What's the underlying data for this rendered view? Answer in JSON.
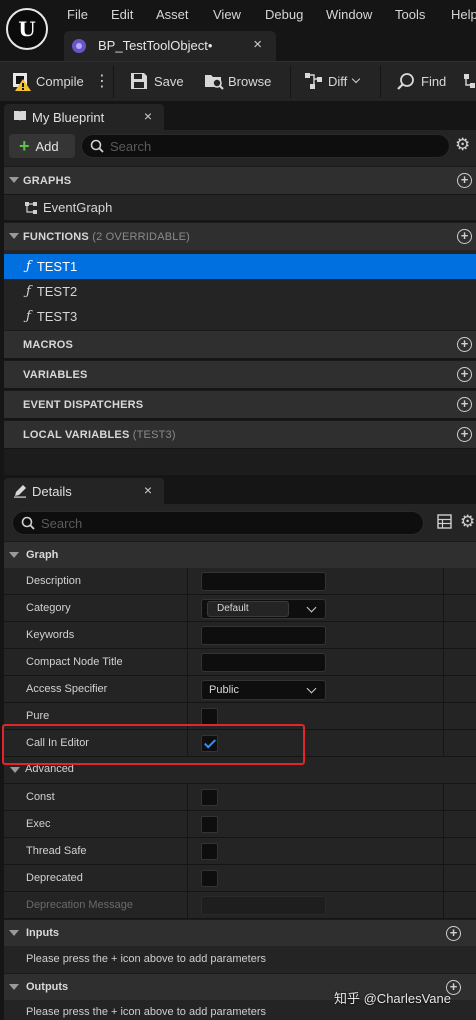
{
  "menu": {
    "items": [
      "File",
      "Edit",
      "Asset",
      "View",
      "Debug",
      "Window",
      "Tools",
      "Help"
    ]
  },
  "document_tab": {
    "title": "BP_TestToolObject•"
  },
  "toolbar": {
    "compile": "Compile",
    "save": "Save",
    "browse": "Browse",
    "diff": "Diff",
    "find": "Find"
  },
  "my_blueprint": {
    "tab_title": "My Blueprint",
    "add_label": "Add",
    "search_placeholder": "Search",
    "sections": {
      "graphs": "GRAPHS",
      "functions": "FUNCTIONS",
      "functions_sub": "(2 OVERRIDABLE)",
      "macros": "MACROS",
      "variables": "VARIABLES",
      "event_dispatchers": "EVENT DISPATCHERS",
      "local_variables": "LOCAL VARIABLES",
      "local_variables_sub": "(TEST3)"
    },
    "graphs": [
      "EventGraph"
    ],
    "functions": [
      "TEST1",
      "TEST2",
      "TEST3"
    ],
    "selected_function": "TEST1"
  },
  "details": {
    "tab_title": "Details",
    "search_placeholder": "Search",
    "graph_section": "Graph",
    "labels": {
      "description": "Description",
      "category": "Category",
      "keywords": "Keywords",
      "compact_node_title": "Compact Node Title",
      "access_specifier": "Access Specifier",
      "pure": "Pure",
      "call_in_editor": "Call In Editor",
      "advanced": "Advanced",
      "const": "Const",
      "exec": "Exec",
      "thread_safe": "Thread Safe",
      "deprecated": "Deprecated",
      "deprecation_message": "Deprecation Message"
    },
    "values": {
      "category": "Default",
      "access_specifier": "Public",
      "pure": false,
      "call_in_editor": true,
      "const": false,
      "exec": false,
      "thread_safe": false,
      "deprecated": false
    },
    "inputs_section": "Inputs",
    "inputs_note": "Please press the + icon above to add parameters",
    "outputs_section": "Outputs",
    "outputs_note": "Please press the + icon above to add parameters"
  },
  "watermark": "知乎 @CharlesVane",
  "colors": {
    "selection": "#0070e0",
    "highlight_box": "#e0262a",
    "add_plus": "#5fc24a",
    "checkbox_check": "#3a8ff0"
  }
}
